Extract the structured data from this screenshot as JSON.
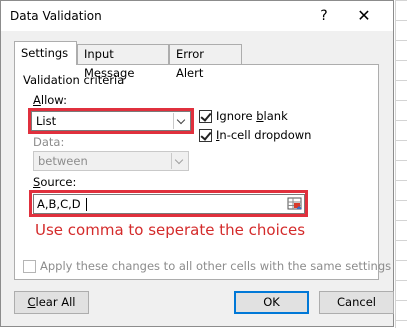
{
  "dialog": {
    "title": "Data Validation",
    "help_glyph": "?",
    "close_glyph": "✕"
  },
  "tabs": [
    {
      "label": "Settings",
      "active": true
    },
    {
      "label": "Input Message",
      "active": false
    },
    {
      "label": "Error Alert",
      "active": false
    }
  ],
  "criteria": {
    "group_title": "Validation criteria",
    "allow_label_first": "A",
    "allow_label_rest": "llow:",
    "allow_value": "List",
    "data_label": "Data:",
    "data_value": "between",
    "source_label_first": "S",
    "source_label_rest": "ource:",
    "source_value": "A,B,C,D",
    "ignore_blank_pre": "Ignore ",
    "ignore_blank_key": "b",
    "ignore_blank_post": "lank",
    "ignore_blank_checked": true,
    "incell_key": "I",
    "incell_post": "n-cell dropdown",
    "incell_checked": true
  },
  "annotation": "Use comma to seperate the choices",
  "apply_all_label": "Apply these changes to all other cells with the same settings",
  "buttons": {
    "clear_all_key": "C",
    "clear_all_rest": "lear All",
    "ok": "OK",
    "cancel": "Cancel"
  },
  "colors": {
    "highlight": "#e0303d",
    "annotation": "#d42b2b",
    "primary_border": "#0078d7"
  },
  "icons": {
    "range_select": "range-selector-icon",
    "help": "question-mark-icon",
    "close": "close-x-icon"
  }
}
